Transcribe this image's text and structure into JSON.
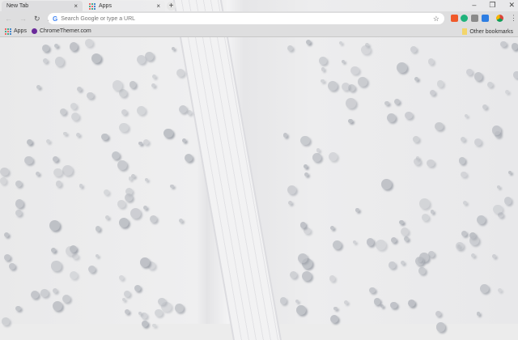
{
  "tabs": [
    {
      "title": "New Tab",
      "active": false
    },
    {
      "title": "Apps",
      "active": true
    }
  ],
  "new_tab_label": "+",
  "window_controls": {
    "minimize": "–",
    "restore": "❐",
    "close": "✕"
  },
  "toolbar": {
    "back": "←",
    "forward": "→",
    "reload": "↻",
    "home": "⌂",
    "omnibox_placeholder": "Search Google or type a URL",
    "star": "☆",
    "menu": "⋮"
  },
  "bookmarks": [
    {
      "label": "Apps"
    },
    {
      "label": "ChromeThemer.com"
    }
  ],
  "other_bookmarks": "Other bookmarks",
  "extension_colors": [
    "#f0592a",
    "#1fb27b",
    "#8a8a8a",
    "#2d7ee3"
  ]
}
